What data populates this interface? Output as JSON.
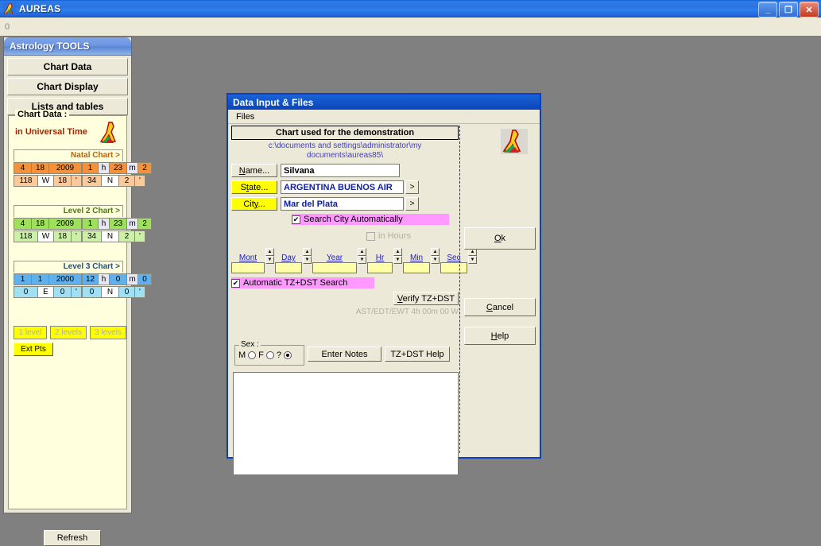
{
  "app": {
    "title": "AUREAS",
    "icon": "astrology-runner-icon",
    "toolbar_label": "0",
    "window_buttons": [
      {
        "name": "minimize",
        "glyph": "_"
      },
      {
        "name": "restore",
        "glyph": "❐"
      },
      {
        "name": "close",
        "glyph": "✕"
      }
    ]
  },
  "sidebar": {
    "title": "Astrology TOOLS",
    "nav": [
      {
        "label": "Chart Data"
      },
      {
        "label": "Chart Display"
      },
      {
        "label": "Lists and tables"
      }
    ],
    "group_legend": "Chart Data :",
    "universal_time": "in Universal Time",
    "refresh_label": "Refresh",
    "level_buttons": [
      {
        "label": "1 level",
        "enabled": false
      },
      {
        "label": "2 levels",
        "enabled": false
      },
      {
        "label": "3 levels",
        "enabled": false
      }
    ],
    "ext_pts_label": "Ext Pts",
    "charts": [
      {
        "heading": "Natal Chart >",
        "date": [
          "4",
          "18",
          "2009"
        ],
        "time": [
          "1",
          "h",
          "23",
          "m",
          "2"
        ],
        "longitude": [
          "118",
          "W",
          "18",
          "'"
        ],
        "latitude": [
          "34",
          "N",
          "2",
          "'"
        ]
      },
      {
        "heading": "Level 2 Chart >",
        "date": [
          "4",
          "18",
          "2009"
        ],
        "time": [
          "1",
          "h",
          "23",
          "m",
          "2"
        ],
        "longitude": [
          "118",
          "W",
          "18",
          "'"
        ],
        "latitude": [
          "34",
          "N",
          "2",
          "'"
        ]
      },
      {
        "heading": "Level 3 Chart >",
        "date": [
          "1",
          "1",
          "2000"
        ],
        "time": [
          "12",
          "h",
          "0",
          "m",
          "0"
        ],
        "longitude": [
          "0",
          "E",
          "0",
          "'"
        ],
        "latitude": [
          "0",
          "N",
          "0",
          "'"
        ]
      }
    ]
  },
  "dialog": {
    "title": "Data Input & Files",
    "menu": [
      "Files"
    ],
    "banner": "Chart used for the demonstration",
    "path": "c:\\documents and settings\\administrator\\my documents\\aureas85\\",
    "logo": "astrology-runner-icon",
    "fields": {
      "name_button": "Name...",
      "name_value": "Silvana",
      "state_button": "State...",
      "state_value": "ARGENTINA BUENOS AIR",
      "city_button": "City...",
      "city_value": "Mar del Plata",
      "browse_glyph": ">"
    },
    "search_city": {
      "label": "Search City Automatically",
      "checked": true
    },
    "in_hours": {
      "label": "in Hours",
      "checked": false,
      "enabled": false
    },
    "spinners": [
      {
        "label": "Mont",
        "value": "",
        "width": 42
      },
      {
        "label": "Day",
        "value": "",
        "width": 34
      },
      {
        "label": "Year",
        "value": "",
        "width": 56
      },
      {
        "label": "Hr",
        "value": "",
        "width": 32
      },
      {
        "label": "Min",
        "value": "",
        "width": 34
      },
      {
        "label": "Sec",
        "value": "",
        "width": 34
      }
    ],
    "auto_tz": {
      "label": "Automatic TZ+DST Search",
      "checked": true
    },
    "verify_tz_label": "Verify TZ+DST",
    "tz_status": "AST/EDT/EWT 4h 00m 00 W",
    "sex": {
      "legend": "Sex :",
      "options": [
        {
          "label": "M",
          "selected": false
        },
        {
          "label": "F",
          "selected": false
        },
        {
          "label": "?",
          "selected": true
        }
      ]
    },
    "enter_notes_label": "Enter Notes",
    "tz_help_label": "TZ+DST Help",
    "notes_value": "",
    "buttons": {
      "ok": "Ok",
      "cancel": "Cancel",
      "help": "Help"
    }
  },
  "colors": {
    "natal": "#f4923b",
    "natal_light": "#fbc99a",
    "level2": "#9de05a",
    "level2_light": "#ccf0a8",
    "level3": "#5eb0ee",
    "level3_light": "#9fe0f5",
    "accent_yellow": "#ffff00",
    "pink": "#ff99ff",
    "desktop": "#808080"
  }
}
